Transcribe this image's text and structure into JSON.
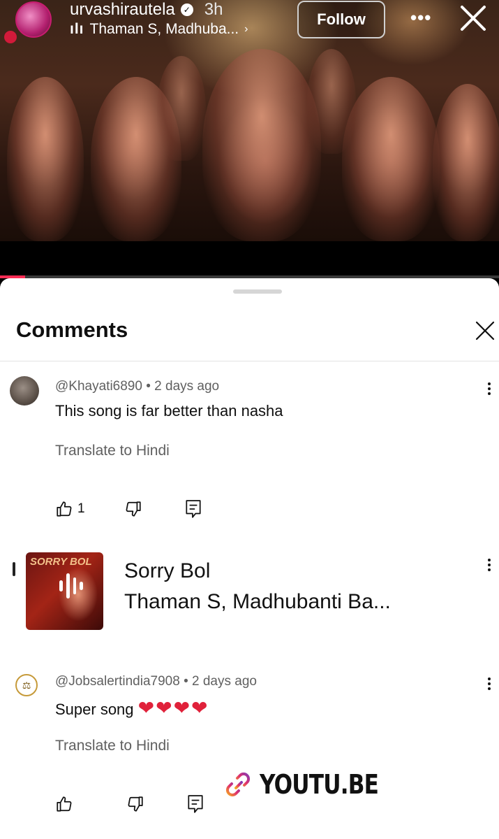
{
  "story": {
    "username": "urvashirautela",
    "time_ago": "3h",
    "music": "Thaman S, Madhuba...",
    "follow_label": "Follow",
    "more_label": "•••",
    "progress": 0.05
  },
  "comments_sheet": {
    "title": "Comments",
    "comments": [
      {
        "author": "@Khayati6890",
        "time": "2 days ago",
        "text": "This song is far better than nasha",
        "translate": "Translate to Hindi",
        "likes": "1"
      },
      {
        "author": "@Jobsalertindia7908",
        "time": "2 days ago",
        "text": "Super song",
        "hearts": "❤❤❤❤",
        "translate": "Translate to Hindi",
        "likes": ""
      }
    ],
    "music_card": {
      "title": "Sorry Bol",
      "artist": "Thaman S, Madhubanti Ba...",
      "art_text": "SORRY BOL"
    }
  },
  "link_sticker": {
    "text": "YOUTU.BE",
    "icon": "link-icon",
    "gradient": [
      "#f5a623",
      "#e1306c",
      "#833ab4"
    ]
  }
}
